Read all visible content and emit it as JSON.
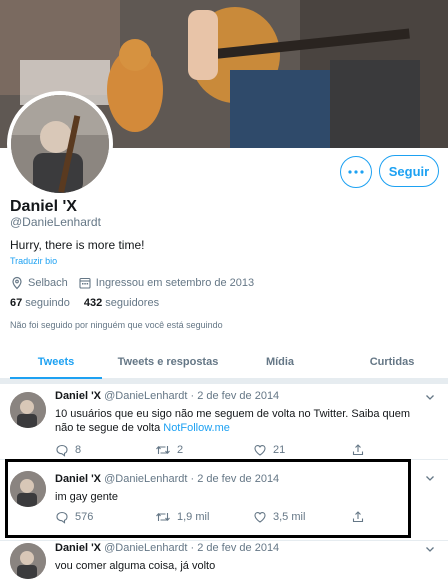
{
  "profile": {
    "name": "Daniel 'X",
    "handle": "@DanieLenhardt",
    "bio": "Hurry, there is more time!",
    "translate_label": "Traduzir bio",
    "location": "Selbach",
    "joined": "Ingressou em setembro de 2013",
    "following_count": "67",
    "following_label": "seguindo",
    "followers_count": "432",
    "followers_label": "seguidores",
    "not_followed_text": "Não foi seguido por ninguém que você está seguindo",
    "follow_label": "Seguir",
    "more_icon": "more-dots-icon"
  },
  "tabs": [
    "Tweets",
    "Tweets e respostas",
    "Mídia",
    "Curtidas"
  ],
  "active_tab": "Tweets",
  "tweets": [
    {
      "name": "Daniel 'X",
      "handle": "@DanieLenhardt",
      "date": "· 2 de fev de 2014",
      "text_line1": "10 usuários que eu sigo não me seguem de volta no Twitter. Saiba quem",
      "text_line2_prefix": "não te segue de volta ",
      "text_link": "NotFollow.me",
      "replies": "8",
      "retweets": "2",
      "likes": "21"
    },
    {
      "name": "Daniel 'X",
      "handle": "@DanieLenhardt",
      "date": "· 2 de fev de 2014",
      "text": "im gay gente",
      "replies": "576",
      "retweets": "1,9 mil",
      "likes": "3,5 mil"
    },
    {
      "name": "Daniel 'X",
      "handle": "@DanieLenhardt",
      "date": "· 2 de fev de 2014",
      "text": "vou comer alguma coisa, já volto"
    }
  ],
  "colors": {
    "accent": "#1da1f2",
    "secondary_text": "#657786",
    "primary_text": "#14171a",
    "highlight_border": "#000000"
  }
}
